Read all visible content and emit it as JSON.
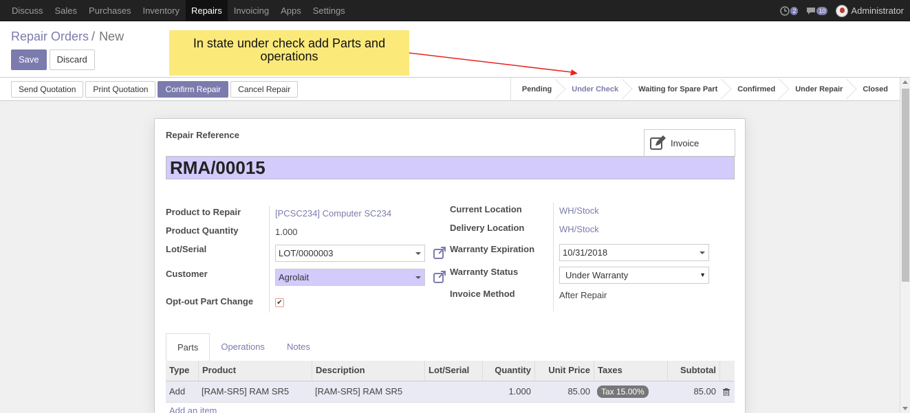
{
  "topbar": {
    "menu": [
      "Discuss",
      "Sales",
      "Purchases",
      "Inventory",
      "Repairs",
      "Invoicing",
      "Apps",
      "Settings"
    ],
    "active": "Repairs",
    "activity_count": "2",
    "message_count": "10",
    "user_name": "Administrator"
  },
  "breadcrumb": {
    "parent": "Repair Orders",
    "separator": "/",
    "current": "New"
  },
  "buttons": {
    "save": "Save",
    "discard": "Discard"
  },
  "annotation": {
    "text": "In state under check add Parts and operations"
  },
  "actions": [
    "Send Quotation",
    "Print Quotation",
    "Confirm Repair",
    "Cancel Repair"
  ],
  "stages": [
    "Pending",
    "Under Check",
    "Waiting for Spare Part",
    "Confirmed",
    "Under Repair",
    "Closed"
  ],
  "active_stage": "Under Check",
  "smart_button": {
    "label": "Invoice"
  },
  "form": {
    "ref_label": "Repair Reference",
    "ref_value": "RMA/00015",
    "product_label": "Product to Repair",
    "product_value": "[PCSC234] Computer SC234",
    "qty_label": "Product Quantity",
    "qty_value": "1.000",
    "lot_label": "Lot/Serial",
    "lot_value": "LOT/0000003",
    "customer_label": "Customer",
    "customer_value": "Agrolait",
    "optout_label": "Opt-out Part Change",
    "curloc_label": "Current Location",
    "curloc_value": "WH/Stock",
    "delloc_label": "Delivery Location",
    "delloc_value": "WH/Stock",
    "wexp_label": "Warranty Expiration",
    "wexp_value": "10/31/2018",
    "wstat_label": "Warranty Status",
    "wstat_value": "Under Warranty",
    "invmeth_label": "Invoice Method",
    "invmeth_value": "After Repair"
  },
  "tabs": [
    "Parts",
    "Operations",
    "Notes"
  ],
  "table": {
    "headers": [
      "Type",
      "Product",
      "Description",
      "Lot/Serial",
      "Quantity",
      "Unit Price",
      "Taxes",
      "Subtotal"
    ],
    "rows": [
      {
        "type": "Add",
        "product": "[RAM-SR5] RAM SR5",
        "description": "[RAM-SR5] RAM SR5",
        "lot": "",
        "quantity": "1.000",
        "unit_price": "85.00",
        "taxes": "Tax 15.00%",
        "subtotal": "85.00"
      }
    ],
    "add_item": "Add an item"
  }
}
